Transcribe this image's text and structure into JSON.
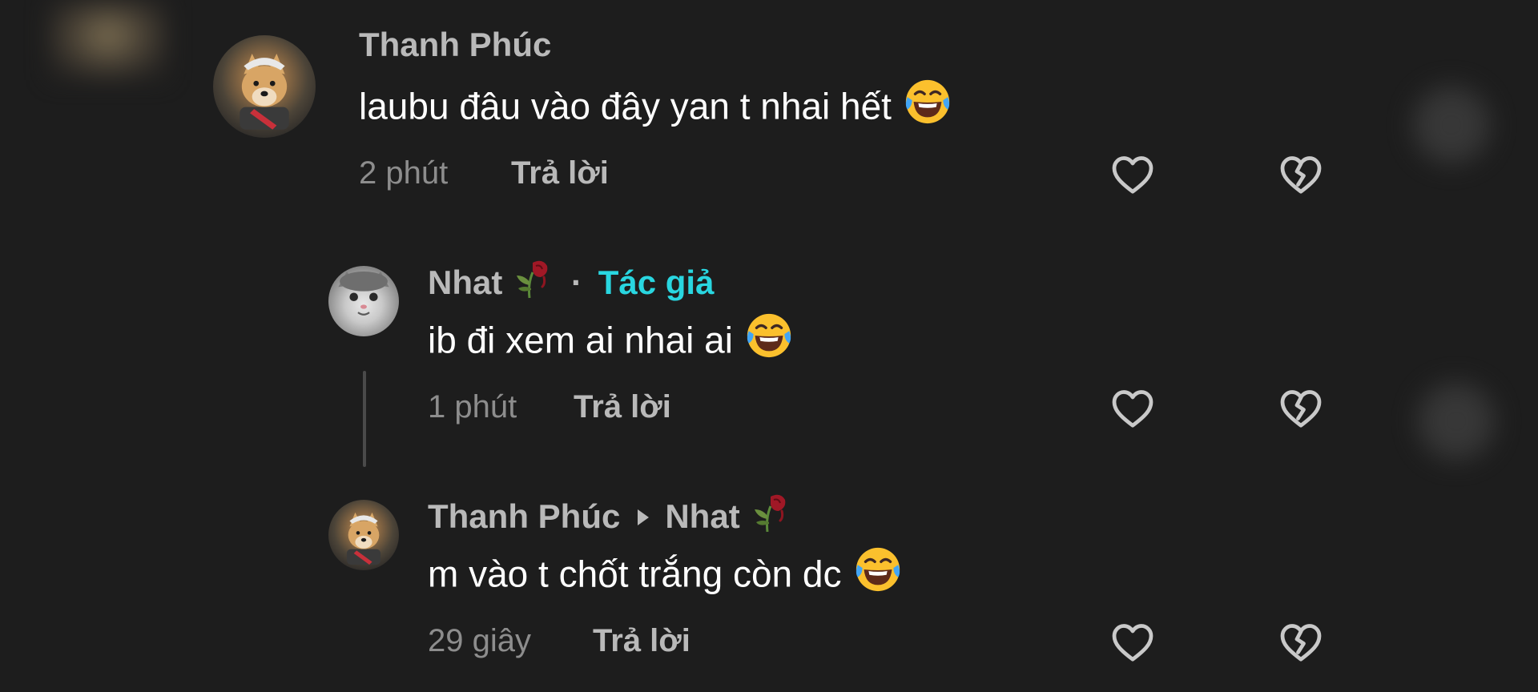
{
  "comments": [
    {
      "username": "Thanh Phúc",
      "text": "laubu đâu vào đây yan t nhai hết",
      "emoji": "tears-of-joy-emoji",
      "time": "2 phút",
      "reply_label": "Trả lời"
    },
    {
      "username": "Nhat",
      "separator": "·",
      "author_badge": "Tác giả",
      "text": "ib đi xem ai nhai ai",
      "emoji": "tears-of-joy-emoji",
      "time": "1 phút",
      "reply_label": "Trả lời"
    },
    {
      "username": "Thanh Phúc",
      "reply_to": "Nhat",
      "text": "m vào t chốt trắng còn dc",
      "emoji": "tears-of-joy-emoji",
      "time": "29 giây",
      "reply_label": "Trả lời"
    }
  ],
  "icons": {
    "like": "heart-outline-icon",
    "dislike": "broken-heart-icon",
    "name_decoration": "wilted-rose-icon"
  },
  "colors": {
    "background": "#1d1d1d",
    "author_badge": "#29d6e0",
    "username": "#b9b9b9",
    "secondary": "#8d8d8d"
  }
}
